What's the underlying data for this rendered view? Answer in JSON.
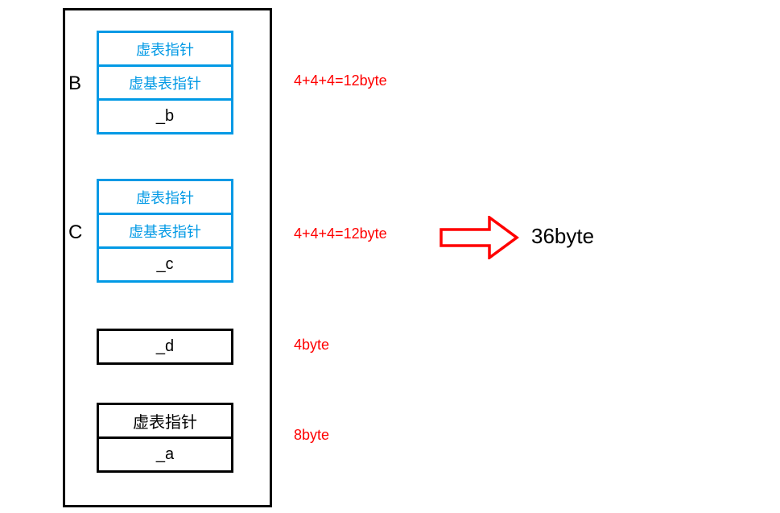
{
  "labels": {
    "b": "B",
    "c": "C"
  },
  "groupB": {
    "row1": "虚表指针",
    "row2": "虚基表指针",
    "row3": "_b"
  },
  "groupC": {
    "row1": "虚表指针",
    "row2": "虚基表指针",
    "row3": "_c"
  },
  "groupD": {
    "row1": "_d"
  },
  "groupA": {
    "row1": "虚表指针",
    "row2": "_a"
  },
  "annotations": {
    "b": "4+4+4=12byte",
    "c": "4+4+4=12byte",
    "d": "4byte",
    "a": "8byte"
  },
  "result": "36byte"
}
